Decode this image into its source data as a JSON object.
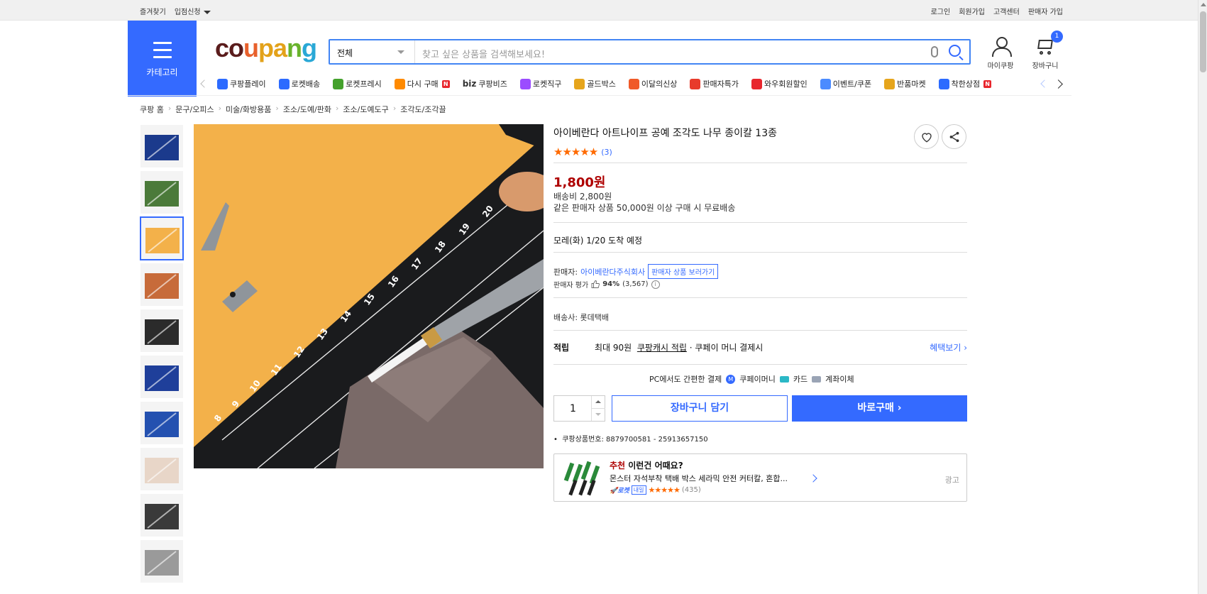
{
  "topbar": {
    "favorites": "즐겨찾기",
    "store_apply": "입점신청",
    "login": "로그인",
    "signup": "회원가입",
    "customer_center": "고객센터",
    "seller_signup": "판매자 가입"
  },
  "header": {
    "category_label": "카테고리",
    "logo_parts": [
      "co",
      "u",
      "pa",
      "n",
      "g"
    ],
    "search": {
      "scope": "전체",
      "placeholder": "찾고 싶은 상품을 검색해보세요!"
    },
    "my_coupang": "마이쿠팡",
    "cart_label": "장바구니",
    "cart_count": "1"
  },
  "category_nav": {
    "items": [
      {
        "label": "쿠팡플레이",
        "icon": "play-icon",
        "color": "#2c6bff"
      },
      {
        "label": "로켓배송",
        "icon": "rocket-icon",
        "color": "#2c6bff"
      },
      {
        "label": "로켓프레시",
        "icon": "rocket-fresh-icon",
        "color": "#44a12c"
      },
      {
        "label": "다시 구매",
        "icon": "repurchase-icon",
        "color": "#ff8a00",
        "new": true
      },
      {
        "label": "쿠팡비즈",
        "icon": "biz-icon",
        "prefix": "biz"
      },
      {
        "label": "로켓직구",
        "icon": "rocket-global-icon",
        "color": "#9b4cff"
      },
      {
        "label": "골드박스",
        "icon": "goldbox-icon",
        "color": "#e6a51c"
      },
      {
        "label": "이달의신상",
        "icon": "new-arrival-icon",
        "color": "#f05a28"
      },
      {
        "label": "판매자특가",
        "icon": "seller-deal-icon",
        "color": "#e83b2b"
      },
      {
        "label": "와우회원할인",
        "icon": "wow-icon",
        "color": "#e8262d"
      },
      {
        "label": "이벤트/쿠폰",
        "icon": "coupon-icon",
        "color": "#4b8bff"
      },
      {
        "label": "반품마켓",
        "icon": "return-market-icon",
        "color": "#e6a51c"
      },
      {
        "label": "착한상점",
        "icon": "good-store-icon",
        "color": "#2c6bff",
        "new": true
      }
    ],
    "new_badge": "N"
  },
  "breadcrumb": [
    "쿠팡 홈",
    "문구/오피스",
    "미술/화방용품",
    "조소/도예/판화",
    "조소/도예도구",
    "조각도/조각끌"
  ],
  "product": {
    "title": "아이베란다 아트나이프 공예 조각도 나무 종이칼 13종",
    "rating_stars": 5,
    "review_count": "(3)",
    "price": "1,800원",
    "shipping_fee": "배송비 2,800원",
    "free_shipping_note": "같은 판매자 상품 50,000원 이상 구매 시 무료배송",
    "arrival": "모레(화) 1/20 도착 예정",
    "seller_label": "판매자:",
    "seller_name": "아이베란다주식회사",
    "seller_more_button": "판매자 상품 보러가기",
    "seller_rating_label": "판매자 평가",
    "seller_rating_percent": "94%",
    "seller_rating_count": "(3,567)",
    "carrier": "배송사:  롯데택배",
    "reward_label": "적립",
    "reward_max": "최대 90원",
    "reward_link": "쿠팡캐시 적립",
    "reward_tail": "· 쿠페이 머니 결제시",
    "benefit_link": "혜택보기 ›",
    "pay_title": "PC에서도 간편한 결제",
    "pay_options": [
      "쿠페이머니",
      "카드",
      "계좌이체"
    ],
    "quantity": "1",
    "add_to_cart": "장바구니 담기",
    "buy_now": "바로구매 ›",
    "product_id": "쿠팡상품번호: 8879700581 - 25913657150",
    "active_thumb_index": 2
  },
  "ad": {
    "head_prefix": "추천",
    "head_rest": " 이런건 어때요?",
    "desc": "몬스터 자석부착 택배 박스 세라믹 안전 커터칼, 혼합...",
    "rocket": "로켓",
    "tag": "내일",
    "stars": 5,
    "count": "(435)",
    "ad_label": "광고"
  }
}
